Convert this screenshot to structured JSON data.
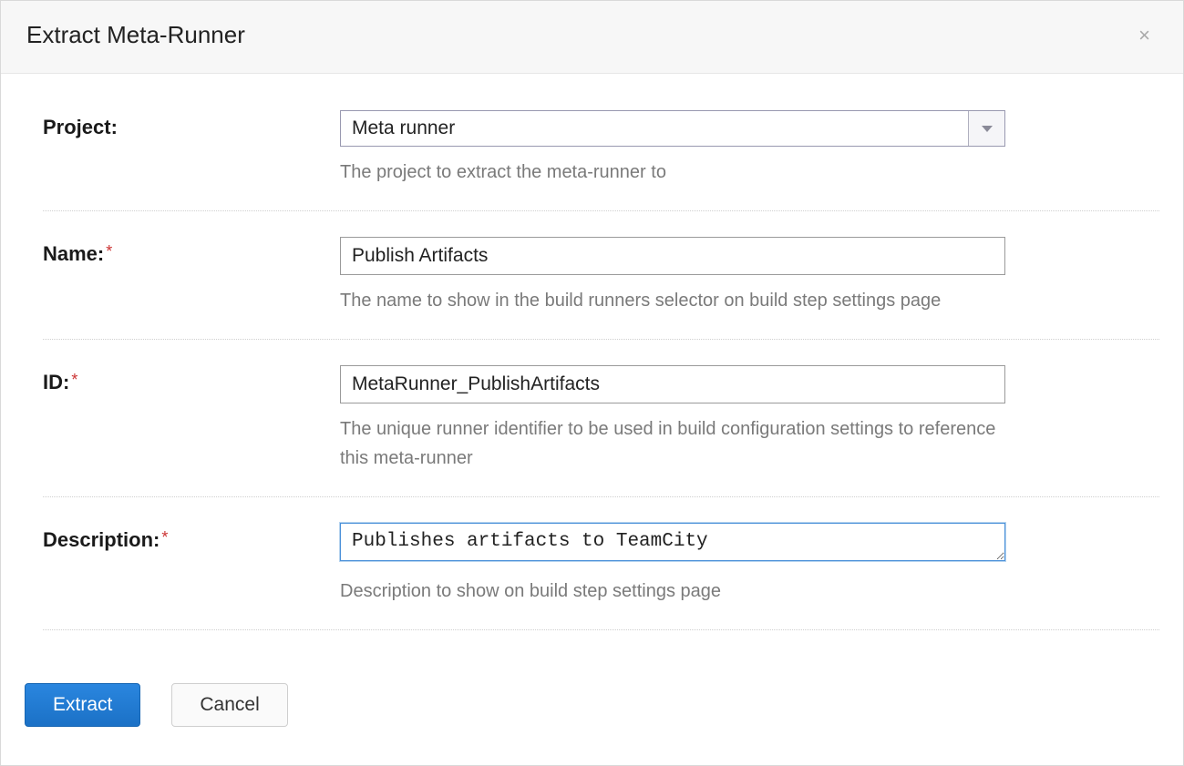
{
  "dialog": {
    "title": "Extract Meta-Runner"
  },
  "form": {
    "project": {
      "label": "Project:",
      "value": "Meta runner",
      "hint": "The project to extract the meta-runner to"
    },
    "name": {
      "label": "Name:",
      "value": "Publish Artifacts",
      "hint": "The name to show in the build runners selector on build step settings page"
    },
    "id": {
      "label": "ID:",
      "value": "MetaRunner_PublishArtifacts",
      "hint": "The unique runner identifier to be used in build configuration settings to reference this meta-runner"
    },
    "description": {
      "label": "Description:",
      "value": "Publishes artifacts to TeamCity",
      "hint": "Description to show on build step settings page"
    }
  },
  "buttons": {
    "extract": "Extract",
    "cancel": "Cancel"
  }
}
